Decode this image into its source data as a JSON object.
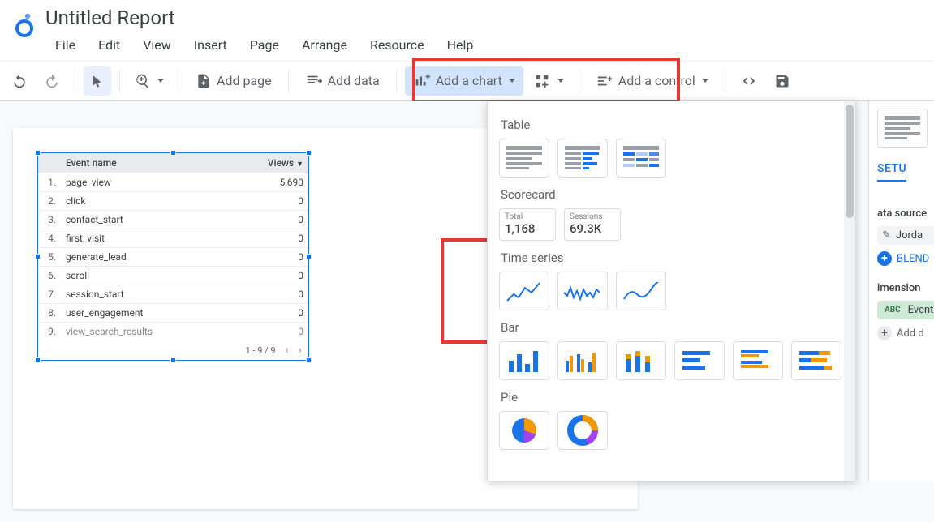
{
  "header": {
    "doc_title": "Untitled Report",
    "menus": [
      "File",
      "Edit",
      "View",
      "Insert",
      "Page",
      "Arrange",
      "Resource",
      "Help"
    ]
  },
  "toolbar": {
    "add_page": "Add page",
    "add_data": "Add data",
    "add_chart": "Add a chart",
    "add_control": "Add a control"
  },
  "table": {
    "headers": {
      "col1": "Event name",
      "col2": "Views"
    },
    "rows": [
      {
        "n": "1.",
        "name": "page_view",
        "views": "5,690"
      },
      {
        "n": "2.",
        "name": "click",
        "views": "0"
      },
      {
        "n": "3.",
        "name": "contact_start",
        "views": "0"
      },
      {
        "n": "4.",
        "name": "first_visit",
        "views": "0"
      },
      {
        "n": "5.",
        "name": "generate_lead",
        "views": "0"
      },
      {
        "n": "6.",
        "name": "scroll",
        "views": "0"
      },
      {
        "n": "7.",
        "name": "session_start",
        "views": "0"
      },
      {
        "n": "8.",
        "name": "user_engagement",
        "views": "0"
      },
      {
        "n": "9.",
        "name": "view_search_results",
        "views": "0"
      }
    ],
    "footer": "1 - 9 / 9"
  },
  "chart_popup": {
    "cat_table": "Table",
    "cat_scorecard": "Scorecard",
    "scorecards": [
      {
        "label": "Total",
        "value": "1,168"
      },
      {
        "label": "Sessions",
        "value": "69.3K"
      }
    ],
    "cat_timeseries": "Time series",
    "cat_bar": "Bar",
    "cat_pie": "Pie"
  },
  "right_panel": {
    "tab": "SETU",
    "section_source": "ata source",
    "source_name": "Jorda",
    "blend": "BLEND",
    "section_dimension": "imension",
    "dim_chip_pill": "ABC",
    "dim_chip_label": "Event",
    "add_dim": "Add d"
  }
}
